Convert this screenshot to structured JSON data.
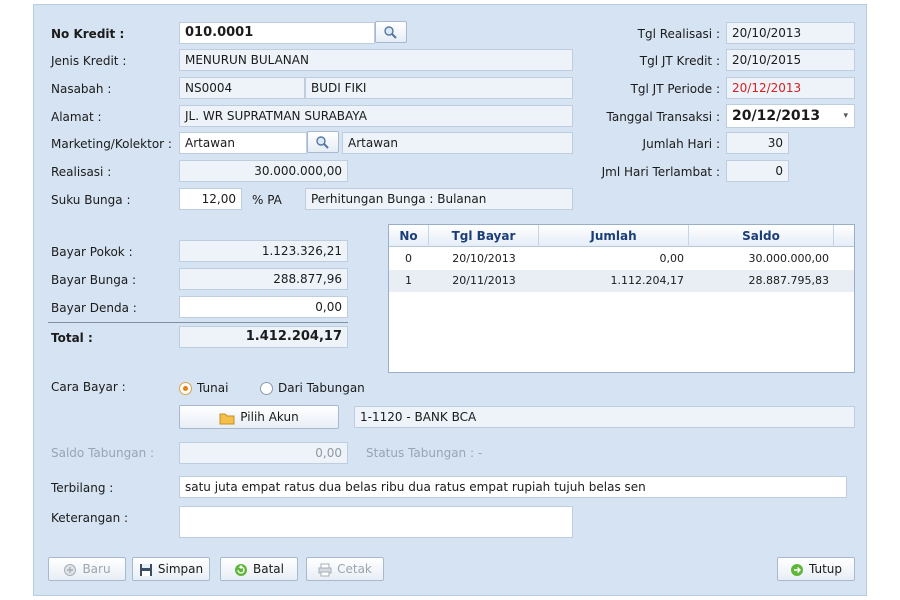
{
  "form": {
    "no_kredit": {
      "label": "No Kredit :",
      "value": "010.0001"
    },
    "jenis_kredit": {
      "label": "Jenis Kredit :",
      "value": "MENURUN BULANAN"
    },
    "nasabah": {
      "label": "Nasabah :",
      "code": "NS0004",
      "name": "BUDI FIKI"
    },
    "alamat": {
      "label": "Alamat :",
      "value": "JL. WR SUPRATMAN SURABAYA"
    },
    "marketing": {
      "label": "Marketing/Kolektor :",
      "code": "Artawan",
      "name": "Artawan"
    },
    "realisasi": {
      "label": "Realisasi :",
      "value": "30.000.000,00"
    },
    "suku_bunga": {
      "label": "Suku Bunga :",
      "value": "12,00",
      "unit": "% PA",
      "perhitungan": "Perhitungan Bunga : Bulanan"
    },
    "bayar_pokok": {
      "label": "Bayar Pokok :",
      "value": "1.123.326,21"
    },
    "bayar_bunga": {
      "label": "Bayar Bunga :",
      "value": "288.877,96"
    },
    "bayar_denda": {
      "label": "Bayar Denda :",
      "value": "0,00"
    },
    "total": {
      "label": "Total :",
      "value": "1.412.204,17"
    },
    "cara_bayar": {
      "label": "Cara Bayar :",
      "option_tunai": "Tunai",
      "option_tabungan": "Dari Tabungan",
      "selected": "Tunai"
    },
    "pilih_akun": {
      "label": "Pilih Akun",
      "value": "1-1120 - BANK BCA"
    },
    "saldo_tabungan": {
      "label": "Saldo Tabungan :",
      "value": "0,00",
      "status": "Status Tabungan : -"
    },
    "terbilang": {
      "label": "Terbilang :",
      "value": "satu juta empat ratus dua belas ribu dua ratus empat rupiah tujuh belas sen"
    },
    "keterangan": {
      "label": "Keterangan :",
      "value": ""
    }
  },
  "right": {
    "tgl_realisasi": {
      "label": "Tgl Realisasi :",
      "value": "20/10/2013"
    },
    "tgl_jt_kredit": {
      "label": "Tgl JT Kredit :",
      "value": "20/10/2015"
    },
    "tgl_jt_periode": {
      "label": "Tgl JT Periode :",
      "value": "20/12/2013"
    },
    "tanggal_transaksi": {
      "label": "Tanggal Transaksi :",
      "value": "20/12/2013"
    },
    "jumlah_hari": {
      "label": "Jumlah Hari :",
      "value": "30"
    },
    "hari_terlambat": {
      "label": "Jml Hari Terlambat :",
      "value": "0"
    }
  },
  "table": {
    "headers": [
      "No",
      "Tgl Bayar",
      "Jumlah",
      "Saldo"
    ],
    "rows": [
      [
        "0",
        "20/10/2013",
        "0,00",
        "30.000.000,00"
      ],
      [
        "1",
        "20/11/2013",
        "1.112.204,17",
        "28.887.795,83"
      ]
    ]
  },
  "buttons": {
    "baru": "Baru",
    "simpan": "Simpan",
    "batal": "Batal",
    "cetak": "Cetak",
    "tutup": "Tutup"
  },
  "colors": {
    "panel_bg": "#d6e3f2",
    "accent_red": "#d42020",
    "header_blue": "#1c3e78"
  }
}
